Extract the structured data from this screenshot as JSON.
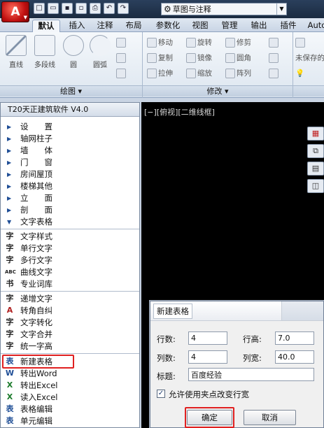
{
  "app": {
    "button_glyph": "A",
    "workspace": "草图与注释",
    "qat_icons": [
      "new-icon",
      "open-icon",
      "save-icon",
      "saveas-icon",
      "print-icon",
      "undo-icon",
      "redo-icon"
    ]
  },
  "tabs": [
    "默认",
    "插入",
    "注释",
    "布局",
    "参数化",
    "视图",
    "管理",
    "输出",
    "插件",
    "Auto"
  ],
  "active_tab": "默认",
  "ribbon": {
    "draw": {
      "label": "绘图",
      "items": [
        "直线",
        "多段线",
        "圆",
        "圆弧"
      ]
    },
    "modify": {
      "label": "修改",
      "items": [
        "移动",
        "旋转",
        "修剪",
        "复制",
        "镜像",
        "圆角",
        "拉伸",
        "缩放",
        "阵列"
      ]
    },
    "layer": {
      "items": [
        "未保存的"
      ]
    }
  },
  "palette": {
    "title": "T20天正建筑软件 V4.0",
    "categories": [
      "设　　置",
      "轴网柱子",
      "墙　　体",
      "门　　窗",
      "房间屋顶",
      "楼梯其他",
      "立　　面",
      "剖　　面"
    ],
    "expanded": "文字表格",
    "sub_items": [
      "文字样式",
      "单行文字",
      "多行文字",
      "曲线文字",
      "专业词库",
      "递增文字",
      "转角自纠",
      "文字转化",
      "文字合并",
      "统一字高",
      "新建表格",
      "转出Word",
      "转出Excel",
      "读入Excel",
      "表格编辑",
      "单元编辑"
    ],
    "sub_icons": [
      "字",
      "字",
      "字",
      "ABC",
      "书",
      "字",
      "A",
      "字",
      "字",
      "字",
      "表",
      "W",
      "X",
      "X",
      "表",
      "表"
    ]
  },
  "viewport": {
    "label": "[−][俯视][二维线框]"
  },
  "dialog": {
    "tab_title": "新建表格",
    "rows_label": "行数:",
    "rows_value": "4",
    "row_height_label": "行高:",
    "row_height_value": "7.0",
    "cols_label": "列数:",
    "cols_value": "4",
    "col_width_label": "列宽:",
    "col_width_value": "40.0",
    "title_label": "标题:",
    "title_value": "百度经验",
    "checkbox_label": "允许使用夹点改变行宽",
    "checkbox_checked": true,
    "ok_label": "确定",
    "cancel_label": "取消"
  },
  "accent": {
    "highlight": "#e02020",
    "app_red": "#c01010"
  }
}
